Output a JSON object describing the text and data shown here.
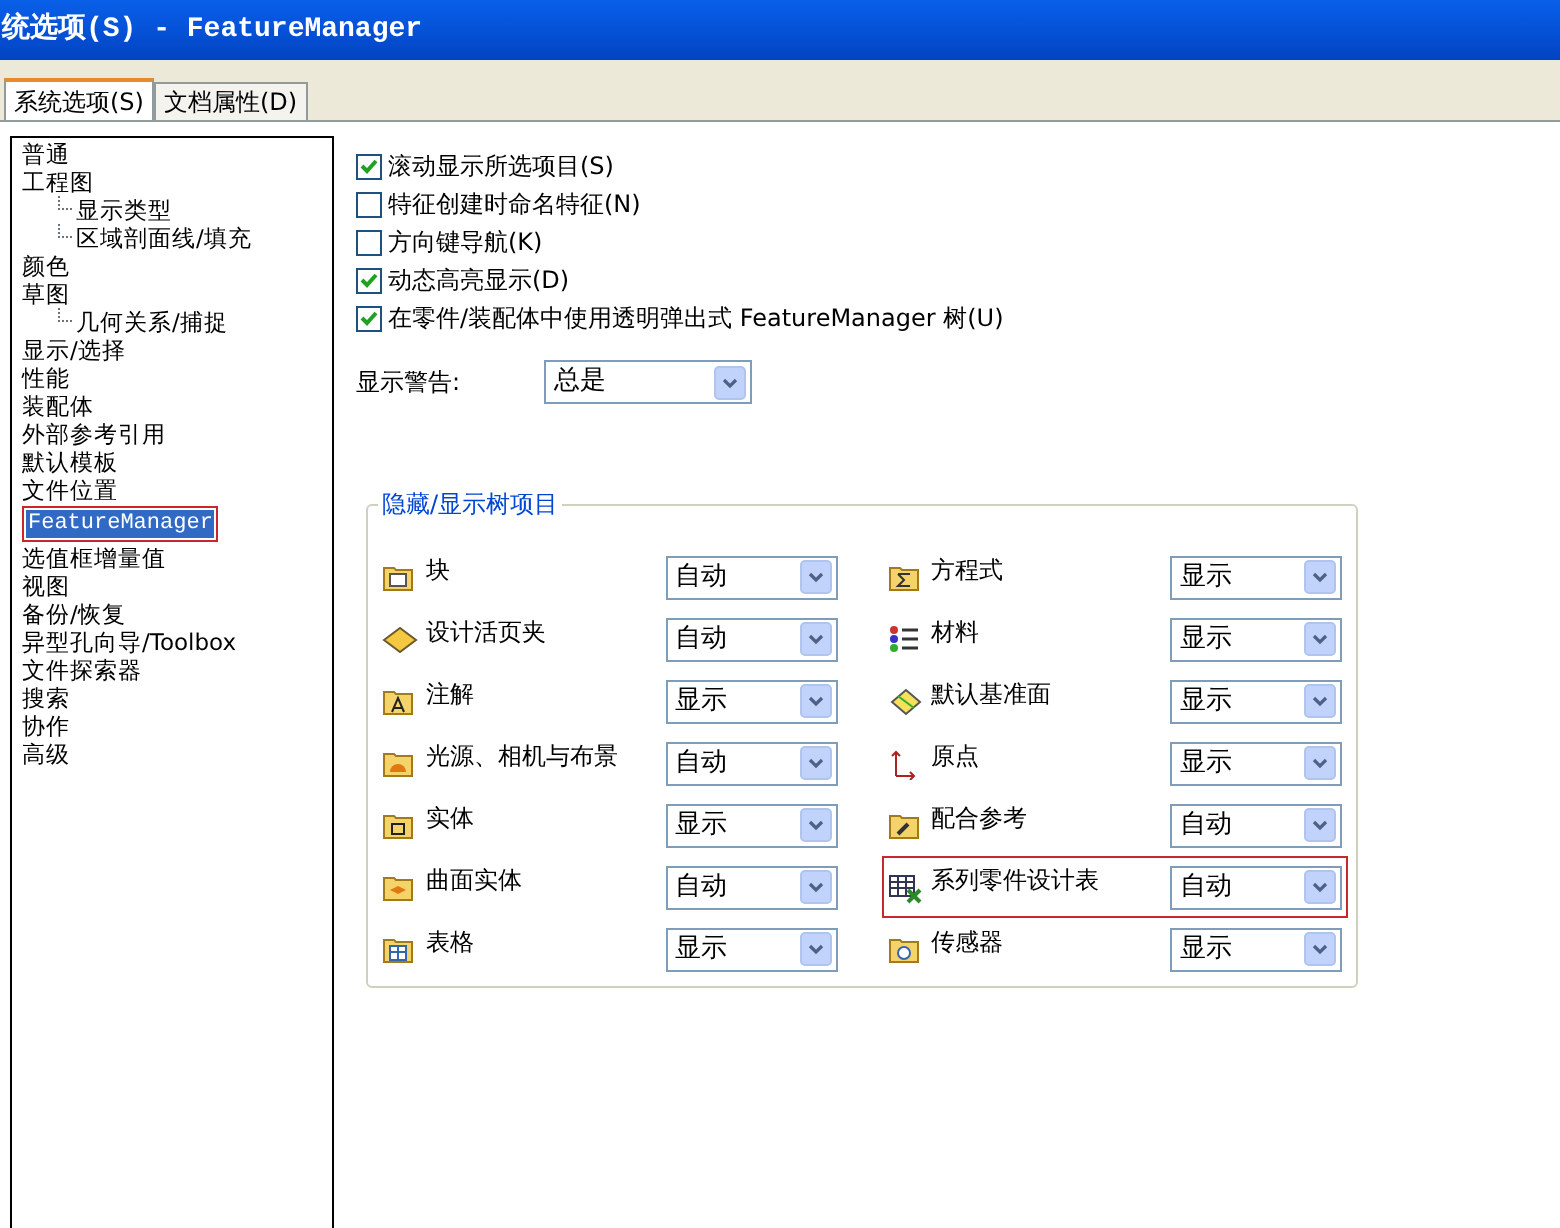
{
  "window": {
    "title": "统选项(S) - FeatureManager"
  },
  "tabs": [
    {
      "label": "系统选项(S)",
      "selected": true
    },
    {
      "label": "文档属性(D)",
      "selected": false
    }
  ],
  "tree": [
    {
      "label": "普通",
      "selected": false,
      "highlighted": false
    },
    {
      "label": "工程图",
      "selected": false,
      "highlighted": false,
      "children": [
        {
          "label": "显示类型",
          "selected": false,
          "highlighted": false
        },
        {
          "label": "区域剖面线/填充",
          "selected": false,
          "highlighted": false
        }
      ]
    },
    {
      "label": "颜色",
      "selected": false,
      "highlighted": false
    },
    {
      "label": "草图",
      "selected": false,
      "highlighted": false,
      "children": [
        {
          "label": "几何关系/捕捉",
          "selected": false,
          "highlighted": false
        }
      ]
    },
    {
      "label": "显示/选择",
      "selected": false,
      "highlighted": false
    },
    {
      "label": "性能",
      "selected": false,
      "highlighted": false
    },
    {
      "label": "装配体",
      "selected": false,
      "highlighted": false
    },
    {
      "label": "外部参考引用",
      "selected": false,
      "highlighted": false
    },
    {
      "label": "默认模板",
      "selected": false,
      "highlighted": false
    },
    {
      "label": "文件位置",
      "selected": false,
      "highlighted": false
    },
    {
      "label": "FeatureManager",
      "selected": true,
      "highlighted": true
    },
    {
      "label": "选值框增量值",
      "selected": false,
      "highlighted": false
    },
    {
      "label": "视图",
      "selected": false,
      "highlighted": false
    },
    {
      "label": "备份/恢复",
      "selected": false,
      "highlighted": false
    },
    {
      "label": "异型孔向导/Toolbox",
      "selected": false,
      "highlighted": false
    },
    {
      "label": "文件探索器",
      "selected": false,
      "highlighted": false
    },
    {
      "label": "搜索",
      "selected": false,
      "highlighted": false
    },
    {
      "label": "协作",
      "selected": false,
      "highlighted": false
    },
    {
      "label": "高级",
      "selected": false,
      "highlighted": false
    }
  ],
  "options": [
    {
      "label": "滚动显示所选项目(S)",
      "checked": true
    },
    {
      "label": "特征创建时命名特征(N)",
      "checked": false
    },
    {
      "label": "方向键导航(K)",
      "checked": false
    },
    {
      "label": "动态高亮显示(D)",
      "checked": true
    },
    {
      "label": "在零件/装配体中使用透明弹出式 FeatureManager 树(U)",
      "checked": true
    }
  ],
  "warning": {
    "label": "显示警告:",
    "value": "总是"
  },
  "group": {
    "title": "隐藏/显示树项目",
    "items": [
      {
        "label": "块",
        "kind": "block",
        "value": "自动",
        "highlighted": false
      },
      {
        "label": "方程式",
        "kind": "sigma",
        "value": "显示",
        "highlighted": false
      },
      {
        "label": "设计活页夹",
        "kind": "binder",
        "value": "自动",
        "highlighted": false
      },
      {
        "label": "材料",
        "kind": "material",
        "value": "显示",
        "highlighted": false
      },
      {
        "label": "注解",
        "kind": "note",
        "value": "显示",
        "highlighted": false
      },
      {
        "label": "默认基准面",
        "kind": "plane",
        "value": "显示",
        "highlighted": false
      },
      {
        "label": "光源、相机与布景",
        "kind": "light",
        "value": "自动",
        "highlighted": false
      },
      {
        "label": "原点",
        "kind": "origin",
        "value": "显示",
        "highlighted": false
      },
      {
        "label": "实体",
        "kind": "solid",
        "value": "显示",
        "highlighted": false
      },
      {
        "label": "配合参考",
        "kind": "mate",
        "value": "自动",
        "highlighted": false
      },
      {
        "label": "曲面实体",
        "kind": "surface",
        "value": "自动",
        "highlighted": false
      },
      {
        "label": "系列零件设计表",
        "kind": "table",
        "value": "自动",
        "highlighted": true
      },
      {
        "label": "表格",
        "kind": "grid",
        "value": "显示",
        "highlighted": false
      },
      {
        "label": "传感器",
        "kind": "sensor",
        "value": "显示",
        "highlighted": false
      }
    ]
  }
}
